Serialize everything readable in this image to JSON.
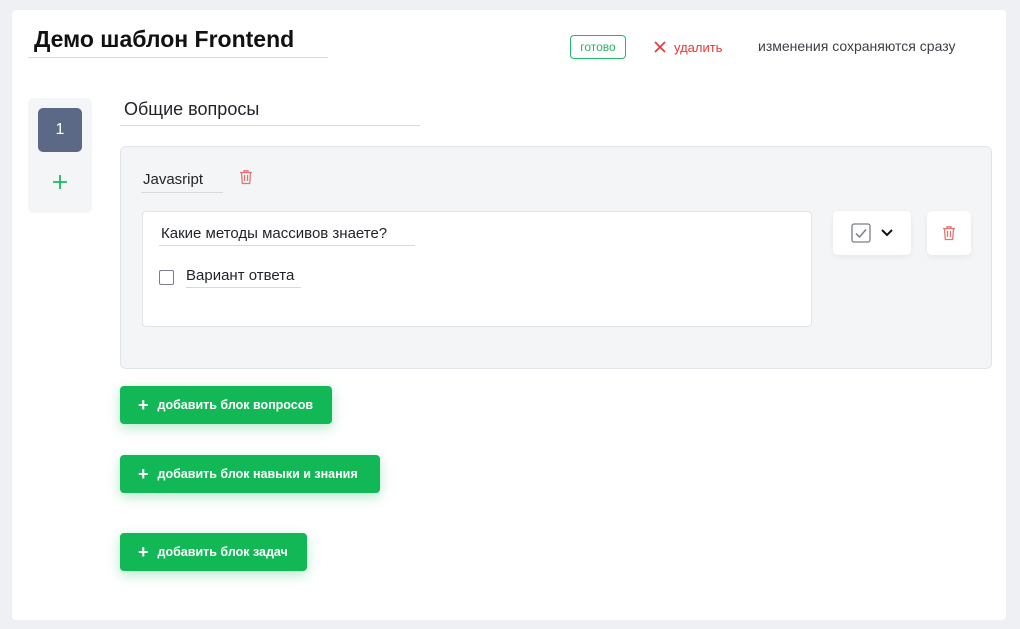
{
  "header": {
    "template_title": "Демо шаблон Frontend",
    "status_badge": "готово",
    "delete_label": "удалить",
    "autosave_note": "изменения сохраняются сразу"
  },
  "stepper": {
    "current_step": "1"
  },
  "section": {
    "title": "Общие вопросы"
  },
  "question_block": {
    "name": "Javasript",
    "question": {
      "text": "Какие методы массивов знаете?",
      "answer_option": "Вариант ответа"
    }
  },
  "actions": {
    "add_question_block": "добавить блок вопросов",
    "add_skills_block": "добавить блок навыки и знания",
    "add_tasks_block": "добавить блок задач"
  },
  "colors": {
    "accent_green": "#12b856",
    "danger_red": "#e53935",
    "step_badge": "#5b6986"
  },
  "icons": [
    "close-icon",
    "plus-icon",
    "trash-icon",
    "checkbox-icon",
    "chevron-down-icon"
  ]
}
